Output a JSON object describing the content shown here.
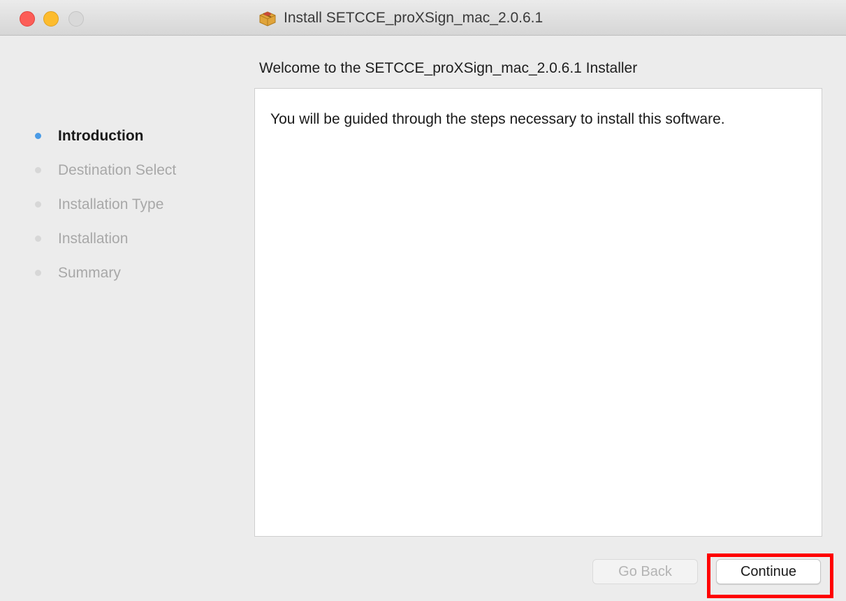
{
  "window": {
    "title": "Install SETCCE_proXSign_mac_2.0.6.1",
    "title_icon": "package-icon"
  },
  "header": {
    "subtitle": "Welcome to the SETCCE_proXSign_mac_2.0.6.1 Installer"
  },
  "sidebar": {
    "steps": [
      {
        "label": "Introduction",
        "active": true
      },
      {
        "label": "Destination Select",
        "active": false
      },
      {
        "label": "Installation Type",
        "active": false
      },
      {
        "label": "Installation",
        "active": false
      },
      {
        "label": "Summary",
        "active": false
      }
    ]
  },
  "main": {
    "body_text": "You will be guided through the steps necessary to install this software."
  },
  "buttons": {
    "go_back": {
      "label": "Go Back",
      "enabled": false
    },
    "continue": {
      "label": "Continue",
      "enabled": true
    }
  },
  "colors": {
    "close": "#fc5d57",
    "minimize": "#fdbc2e",
    "maximize": "#d9d9d9",
    "active_step": "#4a9be6",
    "highlight": "#ff0000"
  }
}
